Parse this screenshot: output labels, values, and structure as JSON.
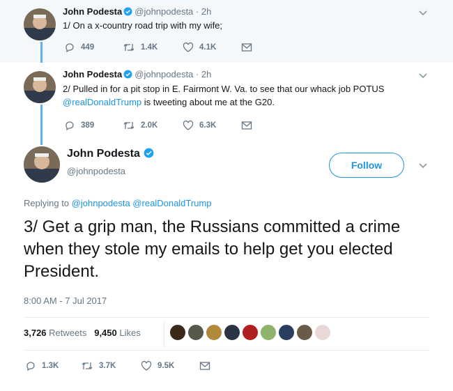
{
  "tweets": [
    {
      "name": "John Podesta",
      "handle": "@johnpodesta",
      "time": "· 2h",
      "text": "1/ On a x-country road trip with my wife;",
      "replies": "449",
      "retweets": "1.4K",
      "likes": "4.1K"
    },
    {
      "name": "John Podesta",
      "handle": "@johnpodesta",
      "time": "· 2h",
      "text_line1": "2/ Pulled in for a pit stop in E. Fairmont W. Va. to see that our whack job POTUS",
      "mention": "@realDonaldTrump",
      "text_line2_rest": " is tweeting about me at the G20.",
      "replies": "389",
      "retweets": "2.0K",
      "likes": "6.3K"
    }
  ],
  "main": {
    "name": "John Podesta",
    "handle": "@johnpodesta",
    "follow_label": "Follow",
    "replying_prefix": "Replying to",
    "replying_to_1": "@johnpodesta",
    "replying_to_2": "@realDonaldTrump",
    "text": "3/ Get a grip man, the Russians committed a crime when they stole my emails to help get you elected President.",
    "timestamp": "8:00 AM - 7 Jul 2017",
    "retweet_count": "3,726",
    "retweet_label": "Retweets",
    "like_count": "9,450",
    "like_label": "Likes",
    "replies": "1.3K",
    "retweets": "3.7K",
    "likes": "9.5K"
  },
  "icons": [
    "chevron-down-icon",
    "verified-badge-icon",
    "reply-icon",
    "retweet-icon",
    "like-icon",
    "direct-message-icon"
  ],
  "colors": {
    "accent": "#1b95e0",
    "thread_line": "#5eb3ee",
    "muted_text": "#657786",
    "reply_background": "#f5f8fa"
  }
}
